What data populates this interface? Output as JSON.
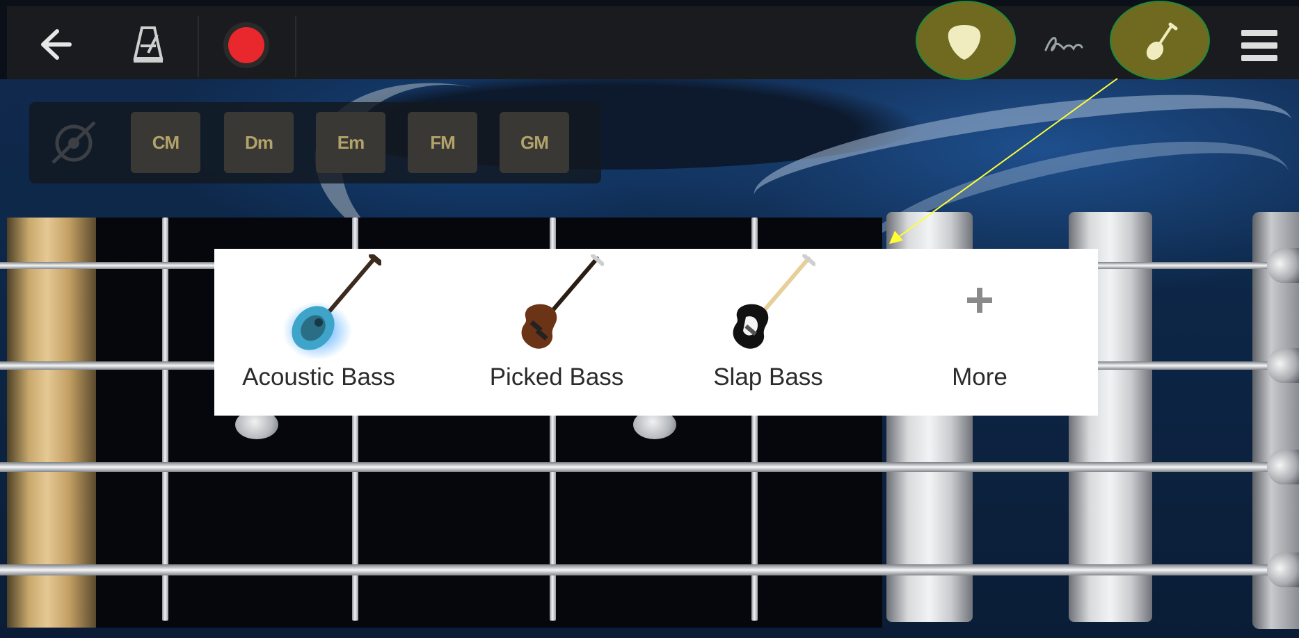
{
  "toolbar": {
    "back_icon": "back-arrow-icon",
    "metronome_icon": "metronome-icon",
    "record_icon": "record-icon",
    "pick_icon": "guitar-pick-icon",
    "style_icon": "signature-icon",
    "instrument_icon": "guitar-icon",
    "menu_icon": "hamburger-menu-icon",
    "record_color": "#e8282c"
  },
  "chords": {
    "edit_icon": "chord-edit-icon",
    "buttons": [
      "CM",
      "Dm",
      "Em",
      "FM",
      "GM"
    ]
  },
  "instrument_popup": {
    "items": [
      {
        "label": "Acoustic Bass",
        "icon": "acoustic-bass-icon"
      },
      {
        "label": "Picked Bass",
        "icon": "picked-bass-icon"
      },
      {
        "label": "Slap Bass",
        "icon": "slap-bass-icon"
      },
      {
        "label": "More",
        "icon": "plus-icon"
      }
    ]
  },
  "annotation": {
    "highlight_color": "#6f6a1f",
    "arrow_color": "#ffff33"
  }
}
